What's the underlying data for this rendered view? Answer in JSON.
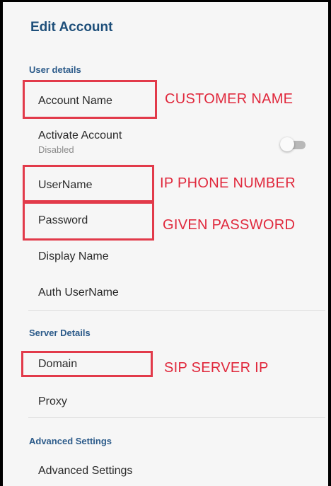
{
  "header": {
    "title": "Edit Account"
  },
  "sections": {
    "user_details": "User details",
    "server_details": "Server Details",
    "advanced_settings": "Advanced Settings"
  },
  "items": {
    "account_name": "Account Name",
    "activate_account": "Activate Account",
    "activate_status": "Disabled",
    "username": "UserName",
    "password": "Password",
    "display_name": "Display Name",
    "auth_username": "Auth UserName",
    "domain": "Domain",
    "proxy": "Proxy",
    "advanced_settings": "Advanced Settings"
  },
  "toggles": {
    "activate_account": false
  },
  "annotations": {
    "account_name": "CUSTOMER NAME",
    "username": "IP PHONE NUMBER",
    "password": "GIVEN PASSWORD",
    "domain": "SIP SERVER IP"
  },
  "colors": {
    "title": "#1e4f7a",
    "section": "#2c5b8a",
    "annotation": "#e0283c",
    "highlight_box": "#e23a4a",
    "background": "#f6f6f6"
  }
}
